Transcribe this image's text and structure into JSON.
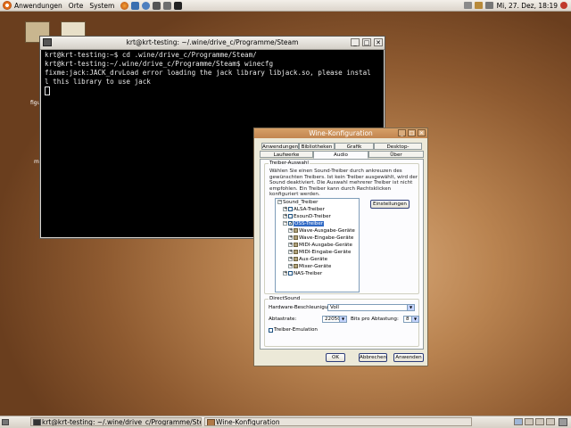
{
  "top_panel": {
    "menus": [
      "Anwendungen",
      "Orte",
      "System"
    ],
    "clock": "Mi, 27. Dez, 18:19"
  },
  "terminal": {
    "title": "krt@krt-testing: ~/.wine/drive_c/Programme/Steam",
    "lines": [
      "krt@krt-testing:~$ cd .wine/drive_c/Programme/Steam/",
      "krt@krt-testing:~/.wine/drive_c/Programme/Steam$ winecfg",
      "fixme:jack:JACK_drvLoad error loading the jack library libjack.so, please instal",
      "l this library to use jack"
    ]
  },
  "wine": {
    "title": "Wine-Konfiguration",
    "tabs_row1": [
      "Anwendungen",
      "Bibliotheken",
      "Grafik",
      "Desktop-Integration"
    ],
    "tabs_row2": [
      "Laufwerke",
      "Audio",
      "Über"
    ],
    "driver_group_title": "Treiber-Auswahl",
    "driver_description": "Wählen Sie einen Sound-Treiber durch ankreuzen des gewünschten Treibers. Ist kein Treiber ausgewählt, wird der Sound deaktiviert. Die Auswahl mehrerer Treiber ist nicht empfohlen. Ein Treiber kann durch Rechtsklicken konfiguriert werden.",
    "settings_button": "Einstellungen",
    "tree": {
      "root": "Sound_Treiber",
      "drivers": [
        "ALSA-Treiber",
        "EsounD-Treiber",
        "OSS-Treiber"
      ],
      "oss_children": [
        "Wave-Ausgabe-Geräte",
        "Wave-Eingabe-Geräte",
        "MIDI-Ausgabe-Geräte",
        "MIDI-Eingabe-Geräte",
        "Aux-Geräte",
        "Mixer-Geräte"
      ],
      "last": "NAS-Treiber"
    },
    "directsound": {
      "title": "DirectSound",
      "hw_label": "Hardware-Beschleunigung:",
      "hw_value": "Voll",
      "rate_label": "Abtastrate:",
      "rate_value": "22050",
      "bits_label": "Bits pro Abtastung:",
      "bits_value": "8",
      "emulation_label": "Treiber-Emulation"
    },
    "buttons": {
      "ok": "OK",
      "cancel": "Abbrechen",
      "apply": "Anwenden"
    }
  },
  "taskbar": {
    "items": [
      "krt@krt-testing: ~/.wine/drive_c/Programme/Steam",
      "Wine-Konfiguration"
    ]
  },
  "colors": {
    "accent": "#e36c17",
    "titlebar": "#c28550",
    "selection": "#316ac5"
  }
}
